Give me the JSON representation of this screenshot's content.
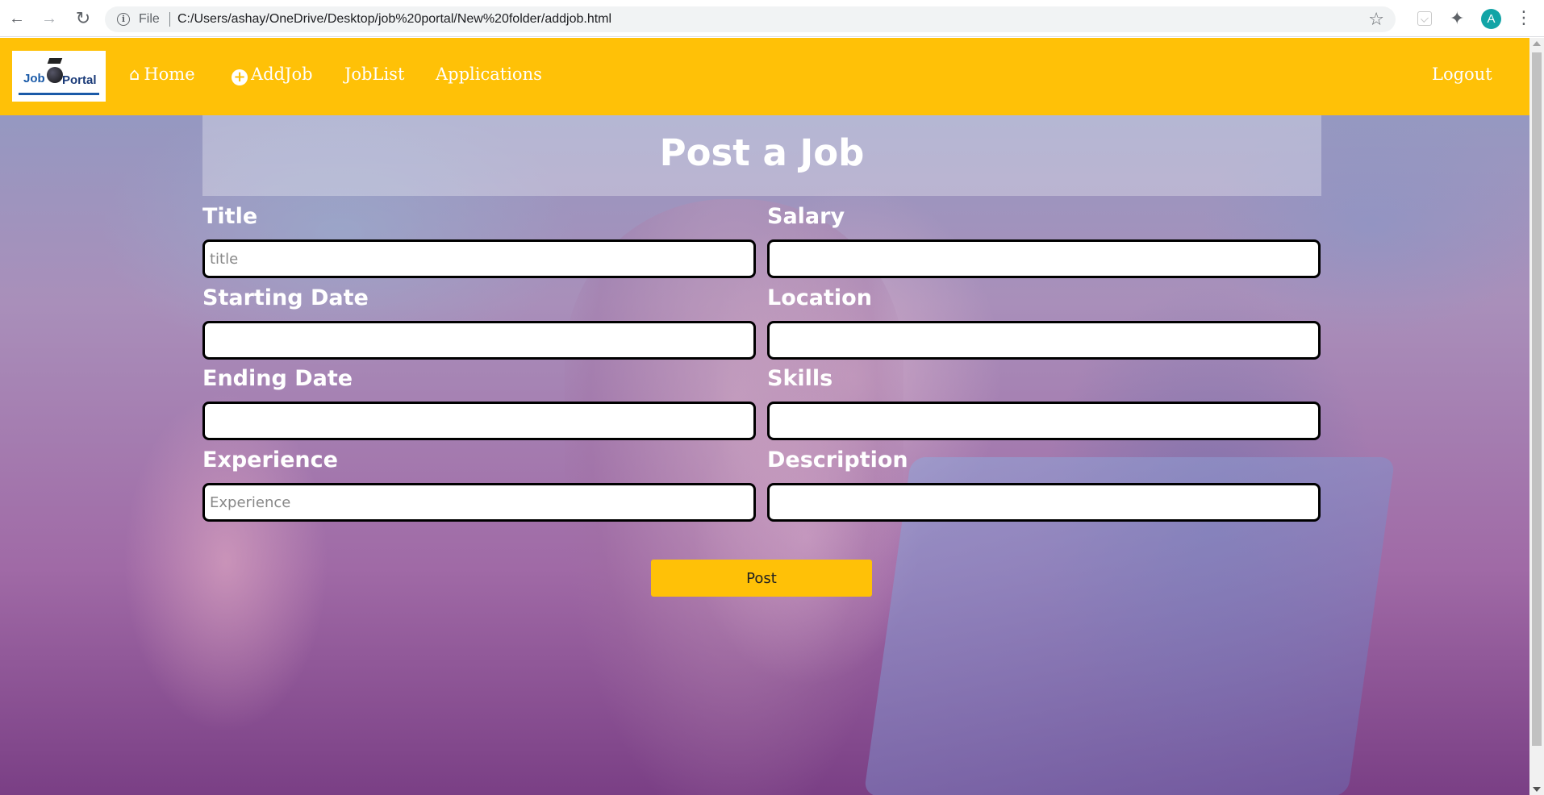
{
  "browser": {
    "file_label": "File",
    "url": "C:/Users/ashay/OneDrive/Desktop/job%20portal/New%20folder/addjob.html",
    "profile_initial": "A"
  },
  "logo": {
    "part1": "Job",
    "part2": "Portal"
  },
  "nav": {
    "home": "Home",
    "addjob": "AddJob",
    "joblist": "JobList",
    "applications": "Applications",
    "logout": "Logout"
  },
  "form": {
    "heading": "Post a Job",
    "title_label": "Title",
    "title_placeholder": "title",
    "salary_label": "Salary",
    "starting_date_label": "Starting Date",
    "location_label": "Location",
    "ending_date_label": "Ending Date",
    "skills_label": "Skills",
    "experience_label": "Experience",
    "experience_placeholder": "Experience",
    "description_label": "Description",
    "submit_label": "Post"
  },
  "colors": {
    "brand": "#ffc107",
    "text_light": "#ffffff",
    "input_border": "#000000"
  }
}
